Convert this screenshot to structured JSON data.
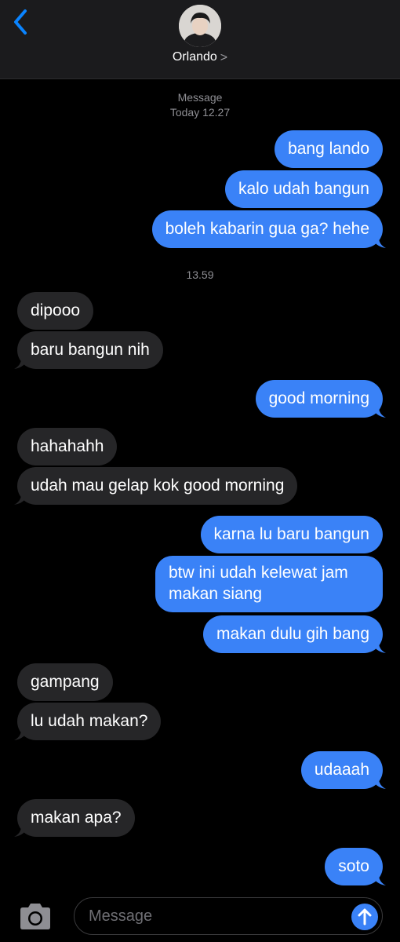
{
  "header": {
    "contact_name": "Orlando",
    "chevron": ">"
  },
  "thread": {
    "label": "Message",
    "first_timestamp": "Today 12.27",
    "second_timestamp": "13.59"
  },
  "messages": [
    {
      "from": "me",
      "text": "bang lando"
    },
    {
      "from": "me",
      "text": "kalo udah bangun"
    },
    {
      "from": "me",
      "text": "boleh kabarin gua ga? hehe"
    },
    {
      "from": "them",
      "text": "dipooo"
    },
    {
      "from": "them",
      "text": "baru bangun nih"
    },
    {
      "from": "me",
      "text": "good morning"
    },
    {
      "from": "them",
      "text": "hahahahh"
    },
    {
      "from": "them",
      "text": "udah mau gelap kok good morning"
    },
    {
      "from": "me",
      "text": "karna lu baru bangun"
    },
    {
      "from": "me",
      "text": "btw ini udah kelewat jam makan siang"
    },
    {
      "from": "me",
      "text": "makan dulu gih bang"
    },
    {
      "from": "them",
      "text": "gampang"
    },
    {
      "from": "them",
      "text": "lu udah makan?"
    },
    {
      "from": "me",
      "text": "udaaah"
    },
    {
      "from": "them",
      "text": "makan apa?"
    },
    {
      "from": "me",
      "text": "soto"
    }
  ],
  "composer": {
    "placeholder": "Message"
  },
  "colors": {
    "outgoing_bubble": "#3a82f7",
    "incoming_bubble": "#262628",
    "background": "#000000",
    "header_background": "#1b1b1d"
  },
  "icons": {
    "back": "chevron-left-icon",
    "camera": "camera-icon",
    "send": "arrow-up-icon"
  }
}
